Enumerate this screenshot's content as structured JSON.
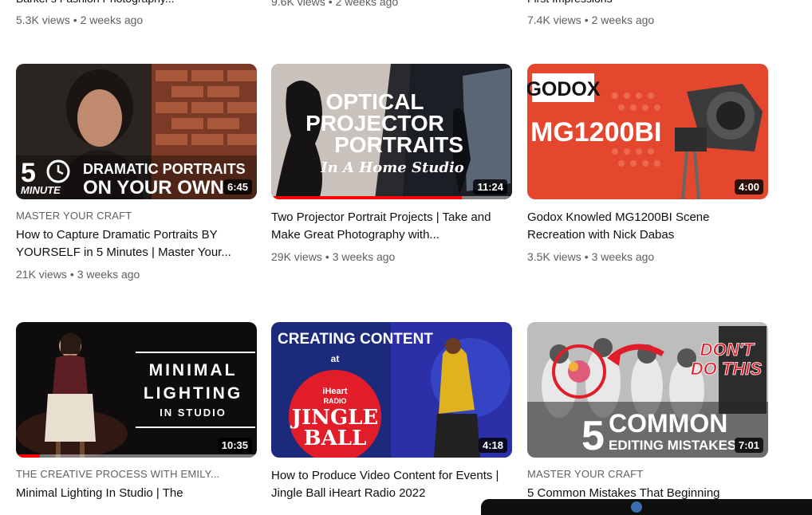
{
  "top_row": [
    {
      "title_partial": "Barker's Fashion Photography...",
      "views": "5.3K views",
      "age": "2 weeks ago"
    },
    {
      "title_partial": "",
      "views": "9.6K views",
      "age": "2 weeks ago"
    },
    {
      "title_partial": "First Impressions",
      "views": "7.4K views",
      "age": "2 weeks ago"
    }
  ],
  "videos": [
    {
      "channel": "MASTER YOUR CRAFT",
      "title": "How to Capture Dramatic Portraits BY YOURSELF in 5 Minutes | Master Your...",
      "views": "21K views",
      "age": "3 weeks ago",
      "duration": "6:45",
      "thumb_text": [
        "5",
        "MINUTE",
        "DRAMATIC PORTRAITS",
        "ON YOUR OWN"
      ],
      "progress": 0
    },
    {
      "channel": "",
      "title": "Two Projector Portrait Projects | Take and Make Great Photography with...",
      "views": "29K views",
      "age": "3 weeks ago",
      "duration": "11:24",
      "thumb_text": [
        "OPTICAL",
        "PROJECTOR",
        "PORTRAITS",
        "In A Home Studio"
      ],
      "progress": 0.79
    },
    {
      "channel": "",
      "title": "Godox Knowled MG1200BI Scene Recreation with Nick Dabas",
      "views": "3.5K views",
      "age": "3 weeks ago",
      "duration": "4:00",
      "thumb_text": [
        "GODOX",
        "MG1200BI"
      ],
      "progress": 0
    },
    {
      "channel": "THE CREATIVE PROCESS WITH EMILY...",
      "title": "Minimal Lighting In Studio | The",
      "views": "",
      "age": "",
      "duration": "10:35",
      "thumb_text": [
        "MINIMAL",
        "LIGHTING",
        "IN STUDIO"
      ],
      "progress": 0.1
    },
    {
      "channel": "",
      "title": "How to Produce Video Content for Events | Jingle Ball iHeart Radio 2022",
      "views": "",
      "age": "",
      "duration": "4:18",
      "thumb_text": [
        "CREATING CONTENT",
        "at",
        "iHeart",
        "RADIO",
        "JINGLE",
        "BALL"
      ],
      "progress": 0
    },
    {
      "channel": "MASTER YOUR CRAFT",
      "title": "5 Common Mistakes That Beginning",
      "views": "",
      "age": "",
      "duration": "7:01",
      "thumb_text": [
        "DON'T",
        "DO THIS",
        "5",
        "COMMON",
        "EDITING MISTAKES"
      ],
      "progress": 0
    }
  ],
  "colors": {
    "progress": "#ff0000",
    "meta": "#606060",
    "title": "#0f0f0f"
  }
}
